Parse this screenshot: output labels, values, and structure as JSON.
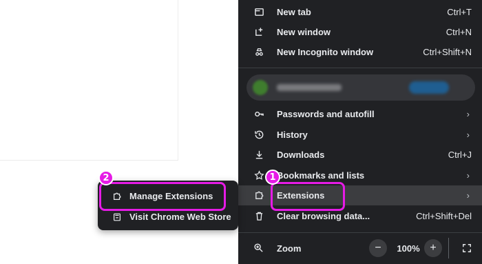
{
  "menu": {
    "items": [
      {
        "label": "New tab",
        "shortcut": "Ctrl+T",
        "icon": "new-tab-icon"
      },
      {
        "label": "New window",
        "shortcut": "Ctrl+N",
        "icon": "new-window-icon"
      },
      {
        "label": "New Incognito window",
        "shortcut": "Ctrl+Shift+N",
        "icon": "incognito-icon"
      },
      {
        "label": "Passwords and autofill",
        "icon": "key-icon"
      },
      {
        "label": "History",
        "icon": "history-icon"
      },
      {
        "label": "Downloads",
        "shortcut": "Ctrl+J",
        "icon": "download-icon"
      },
      {
        "label": "Bookmarks and lists",
        "icon": "star-icon"
      },
      {
        "label": "Extensions",
        "icon": "puzzle-icon"
      },
      {
        "label": "Clear browsing data...",
        "shortcut": "Ctrl+Shift+Del",
        "icon": "trash-icon"
      }
    ],
    "chevron": "›",
    "zoom": {
      "label": "Zoom",
      "value": "100%",
      "minus": "−",
      "plus": "+"
    }
  },
  "submenu": {
    "items": [
      {
        "label": "Manage Extensions",
        "icon": "puzzle-icon"
      },
      {
        "label": "Visit Chrome Web Store",
        "icon": "web-store-icon"
      }
    ]
  },
  "annotations": {
    "step1": "1",
    "step2": "2"
  },
  "colors": {
    "menu_bg": "#202124",
    "menu_text": "#e8eaed",
    "highlight_bg": "#3c3d40",
    "callout": "#e61be6"
  }
}
